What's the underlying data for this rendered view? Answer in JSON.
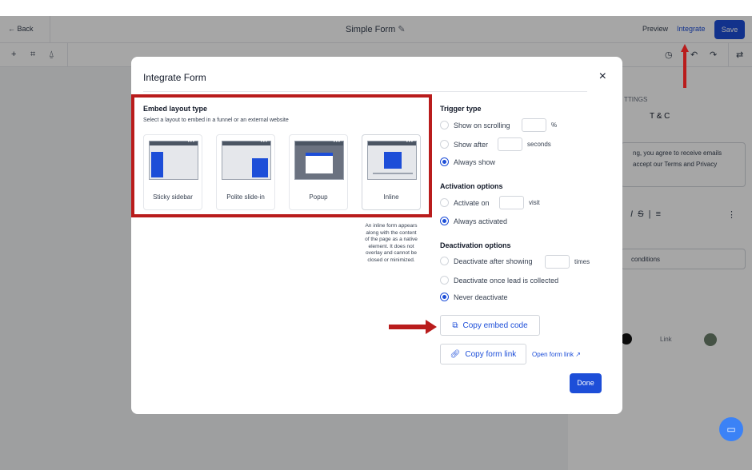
{
  "header": {
    "back_label": "← Back",
    "title": "Simple Form",
    "preview_label": "Preview",
    "integrate_label": "Integrate",
    "save_label": "Save"
  },
  "toolbar": {
    "icons": [
      "plus-icon",
      "layers-icon",
      "bell-icon",
      "history-icon",
      "undo-icon",
      "redo-icon",
      "settings-icon"
    ],
    "add_glyph": "+",
    "layers_glyph": "⌗",
    "bell_glyph": "⍙",
    "history_glyph": "◷",
    "undo_glyph": "↶",
    "redo_glyph": "↷",
    "settings_glyph": "⇄"
  },
  "right_panel": {
    "settings_heading": "TTINGS",
    "tc_label": "T & C",
    "consent_text_line1": "ng, you agree to receive emails",
    "consent_text_line2": "accept our Terms and Privacy",
    "format_italic": "I",
    "format_strike": "S",
    "format_list": "≡",
    "format_more": "⋮",
    "field_text": "conditions",
    "link_label": "Link"
  },
  "modal": {
    "title": "Integrate Form",
    "close_label": "×",
    "embed_layout_title": "Embed layout type",
    "embed_layout_subtitle": "Select a layout to embed in a funnel or an external website",
    "layouts": [
      {
        "label": "Sticky sidebar"
      },
      {
        "label": "Polite slide-in"
      },
      {
        "label": "Popup"
      },
      {
        "label": "Inline"
      }
    ],
    "inline_description": "An inline form appears along with the content of the page as a native element. It does not overlay and cannot be closed or minimized.",
    "trigger": {
      "title": "Trigger type",
      "show_on_scrolling": "Show on scrolling",
      "percent_unit": "%",
      "show_after": "Show after",
      "seconds_unit": "seconds",
      "always_show": "Always show",
      "selected": "Always show"
    },
    "activation": {
      "title": "Activation options",
      "activate_on": "Activate on",
      "visit_unit": "visit",
      "always_activated": "Always activated",
      "selected": "Always activated"
    },
    "deactivation": {
      "title": "Deactivation options",
      "deactivate_after": "Deactivate after showing",
      "times_unit": "times",
      "deactivate_once": "Deactivate once lead is collected",
      "never": "Never deactivate",
      "selected": "Never deactivate"
    },
    "copy_embed_label": "Copy embed code",
    "copy_link_label": "Copy form link",
    "open_link_label": "Open form link",
    "done_label": "Done"
  },
  "colors": {
    "accent": "#1d4ed8",
    "annotation": "#b91c1c"
  }
}
